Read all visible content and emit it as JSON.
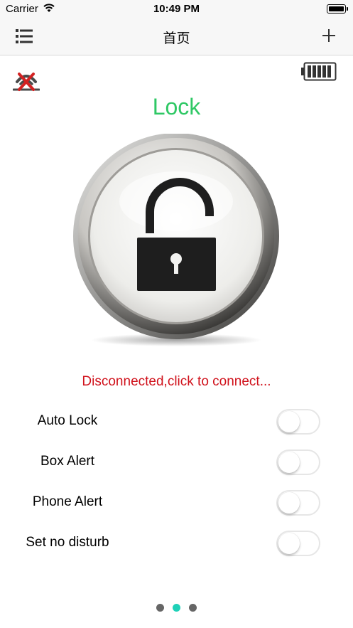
{
  "status_bar": {
    "carrier": "Carrier",
    "time": "10:49 PM"
  },
  "nav": {
    "title": "首页",
    "left_icon": "list-menu-icon",
    "right_icon": "plus-icon"
  },
  "main": {
    "bluetooth_icon": "bluetooth-disconnected-icon",
    "battery_icon": "battery-full-icon",
    "lock_title": "Lock",
    "lock_icon": "unlocked-padlock-icon",
    "status_message": "Disconnected,click to connect...",
    "settings": [
      {
        "label": "Auto Lock",
        "on": false
      },
      {
        "label": "Box Alert",
        "on": false
      },
      {
        "label": "Phone Alert",
        "on": false
      },
      {
        "label": "Set no disturb",
        "on": false
      }
    ]
  },
  "pager": {
    "pages": 3,
    "current": 2
  },
  "colors": {
    "lock_title": "#2fc865",
    "status_message": "#d0111b",
    "active_dot": "#1fd1b8",
    "inactive_dot": "#666666"
  }
}
